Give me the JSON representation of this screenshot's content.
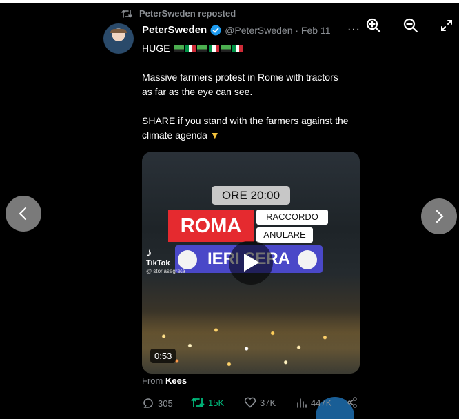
{
  "repost": {
    "label": "PeterSweden reposted"
  },
  "author": {
    "display_name": "PeterSweden",
    "handle_date": "@PeterSweden · Feb 11",
    "more": "···"
  },
  "tweet": {
    "line1": "HUGE",
    "paragraph2": "Massive farmers protest in Rome with tractors as far as the eye can see.",
    "paragraph3": "SHARE if you stand with the farmers against the climate agenda"
  },
  "video": {
    "time_label": "ORE 20:00",
    "city": "ROMA",
    "tag1": "RACCORDO",
    "tag2": "ANULARE",
    "banner": "IERI SERA",
    "tiktok_brand": "TikTok",
    "tiktok_user": "@ storiasegreta",
    "duration": "0:53"
  },
  "attribution": {
    "prefix": "From",
    "name": "Kees"
  },
  "actions": {
    "replies": "305",
    "reposts": "15K",
    "likes": "37K",
    "views": "447K"
  },
  "colors": {
    "repost_green": "#00ba7c",
    "verified_blue": "#1d9bf0",
    "muted": "#8b8f94"
  },
  "icons": [
    "retweet-icon",
    "verified-badge-icon",
    "zoom-in-icon",
    "zoom-out-icon",
    "expand-icon",
    "chevron-left-icon",
    "chevron-right-icon",
    "play-icon",
    "reply-icon",
    "heart-icon",
    "views-icon",
    "share-icon"
  ]
}
